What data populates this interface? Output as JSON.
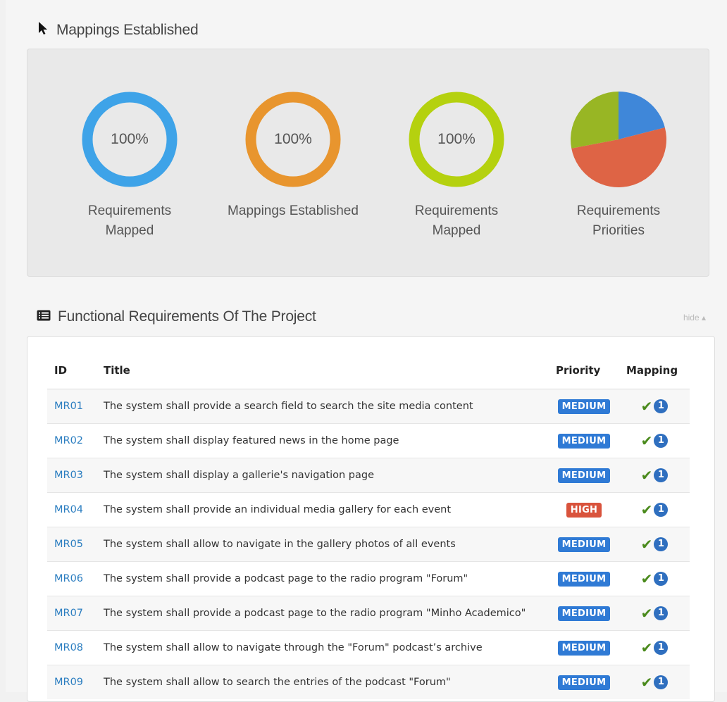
{
  "section1": {
    "title": "Mappings Established"
  },
  "stats": [
    {
      "percent": "100%",
      "label": "Requirements Mapped",
      "color": "#3ea3e8"
    },
    {
      "percent": "100%",
      "label": "Mappings Established",
      "color": "#e8952e"
    },
    {
      "percent": "100%",
      "label": "Requirements Mapped",
      "color": "#b5d10f"
    },
    {
      "label": "Requirements Priorities"
    }
  ],
  "pie": {
    "slices": [
      {
        "name": "blue",
        "color": "#3f87d9",
        "fraction": 0.21
      },
      {
        "name": "red",
        "color": "#de6445",
        "fraction": 0.51
      },
      {
        "name": "green",
        "color": "#98b624",
        "fraction": 0.28
      }
    ]
  },
  "section2": {
    "title": "Functional Requirements Of The Project",
    "hide_label": "hide ▴"
  },
  "table": {
    "headers": {
      "id": "ID",
      "title": "Title",
      "priority": "Priority",
      "mapping": "Mapping"
    },
    "rows": [
      {
        "id": "MR01",
        "title": "The system shall provide a search field to search the site media content",
        "priority": "MEDIUM",
        "count": "1"
      },
      {
        "id": "MR02",
        "title": "The system shall display featured news in the home page",
        "priority": "MEDIUM",
        "count": "1"
      },
      {
        "id": "MR03",
        "title": "The system shall display a gallerie's navigation page",
        "priority": "MEDIUM",
        "count": "1"
      },
      {
        "id": "MR04",
        "title": "The system shall provide an individual media gallery for each event",
        "priority": "HIGH",
        "count": "1"
      },
      {
        "id": "MR05",
        "title": "The system shall allow to navigate in the gallery photos of all events",
        "priority": "MEDIUM",
        "count": "1"
      },
      {
        "id": "MR06",
        "title": "The system shall provide a podcast page to the radio program \"Forum\"",
        "priority": "MEDIUM",
        "count": "1"
      },
      {
        "id": "MR07",
        "title": "The system shall provide a podcast page to the radio program \"Minho Academico\"",
        "priority": "MEDIUM",
        "count": "1"
      },
      {
        "id": "MR08",
        "title": "The system shall allow to navigate through the \"Forum\" podcast’s archive",
        "priority": "MEDIUM",
        "count": "1"
      },
      {
        "id": "MR09",
        "title": "The system shall allow to search the entries of the podcast \"Forum\"",
        "priority": "MEDIUM",
        "count": "1"
      }
    ]
  }
}
